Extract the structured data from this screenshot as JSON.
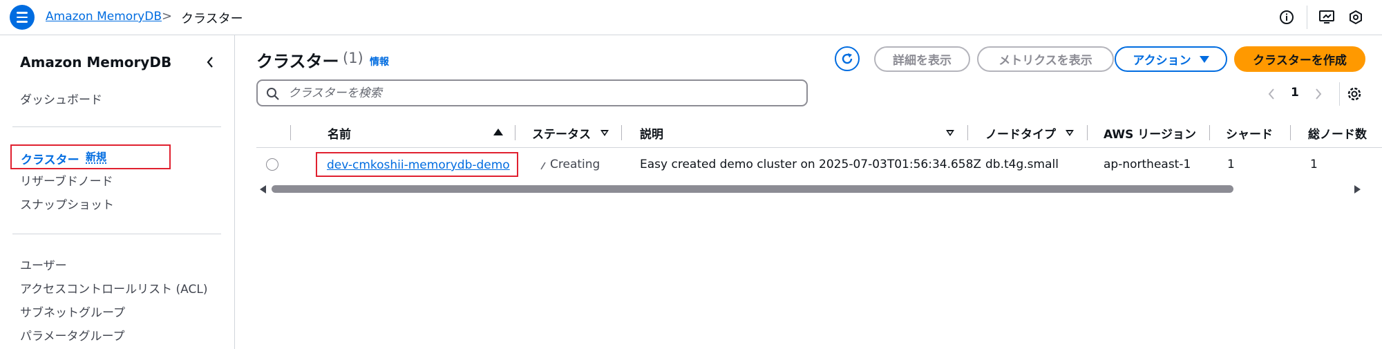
{
  "topbar": {
    "breadcrumb_service": "Amazon MemoryDB",
    "breadcrumb_separator": ">",
    "breadcrumb_current": "クラスター"
  },
  "sidebar": {
    "title": "Amazon MemoryDB",
    "dashboard": "ダッシュボード",
    "clusters": "クラスター",
    "clusters_badge": "新規",
    "reserved_nodes": "リザーブドノード",
    "snapshots": "スナップショット",
    "users": "ユーザー",
    "acl": "アクセスコントロールリスト (ACL)",
    "subnet_groups": "サブネットグループ",
    "parameter_groups": "パラメータグループ"
  },
  "main": {
    "title": "クラスター",
    "count": "(1)",
    "info": "情報",
    "buttons": {
      "details": "詳細を表示",
      "metrics": "メトリクスを表示",
      "actions": "アクション",
      "create": "クラスターを作成"
    },
    "search_placeholder": "クラスターを検索",
    "page_number": "1"
  },
  "table": {
    "headers": {
      "name": "名前",
      "status": "ステータス",
      "description": "説明",
      "node_type": "ノードタイプ",
      "region": "AWS リージョン",
      "shards": "シャード",
      "total_nodes": "総ノード数"
    },
    "rows": [
      {
        "name": "dev-cmkoshii-memorydb-demo",
        "status": "Creating",
        "description": "Easy created demo cluster on 2025-07-03T01:56:34.658Z",
        "node_type": "db.t4g.small",
        "region": "ap-northeast-1",
        "shards": "1",
        "total_nodes": "1"
      }
    ]
  },
  "colors": {
    "link_blue": "#006ce0",
    "primary_orange": "#ff9900",
    "highlight_red": "#e0202f"
  }
}
